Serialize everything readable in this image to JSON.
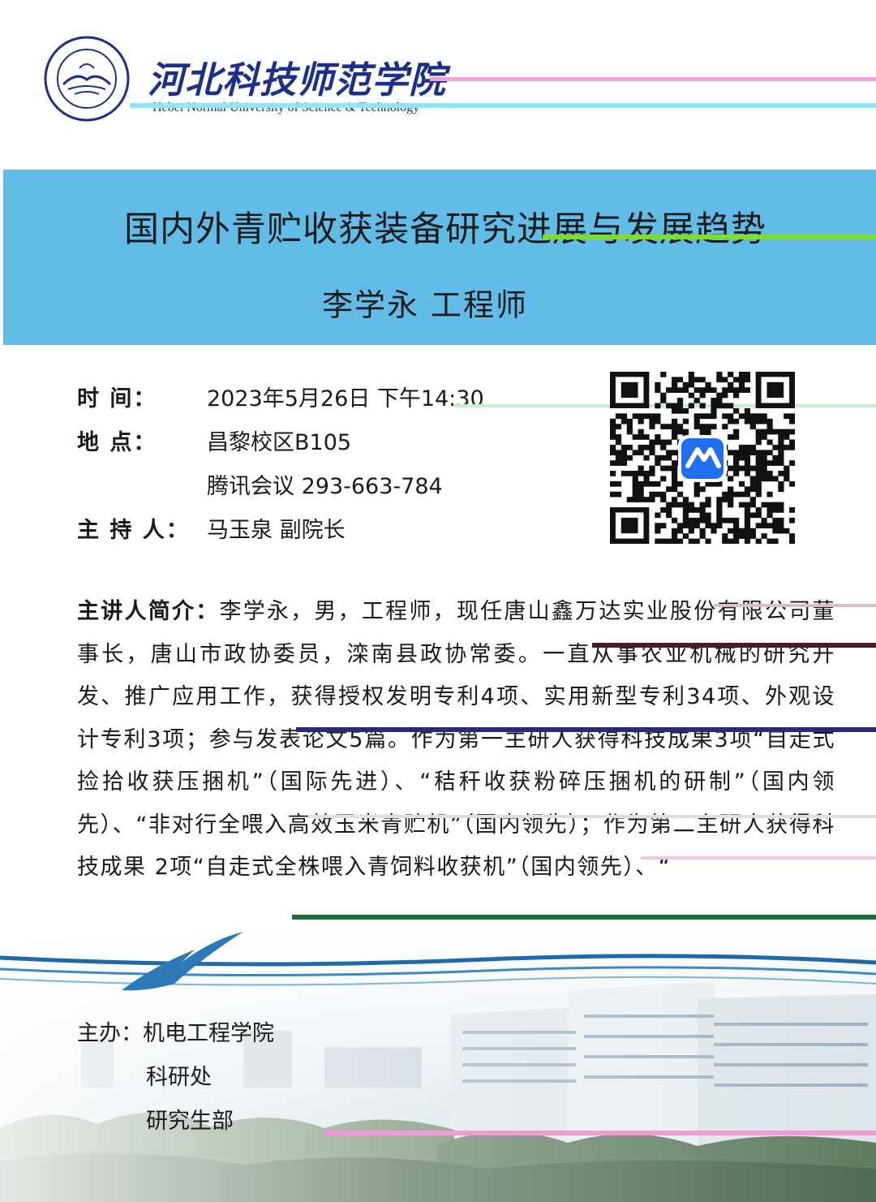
{
  "header": {
    "university_cn": "河北科技师范学院",
    "university_en": "Hebei Normal University of Science & Technology",
    "seal_icon": "university-seal-icon",
    "brand_color": "#1d2f8c"
  },
  "banner": {
    "title": "国内外青贮收获装备研究进展与发展趋势",
    "speaker": "李学永  工程师",
    "background_color": "#61bde8"
  },
  "info": {
    "time_label": "时  间：",
    "time_value": "2023年5月26日 下午14:30",
    "place_label": "地  点：",
    "place_value": "昌黎校区B105",
    "meeting_value": "腾讯会议 293-663-784",
    "host_label": "主 持 人：",
    "host_value": "马玉泉 副院长"
  },
  "qr": {
    "icon": "tencent-meeting-icon"
  },
  "intro": {
    "label": "主讲人简介：",
    "text": "李学永，男，工程师，现任唐山鑫万达实业股份有限公司董事长，唐山市政协委员，滦南县政协常委。一直从事农业机械的研究开发、推广应用工作，获得授权发明专利4项、实用新型专利34项、外观设计专利3项；参与发表论文5篇。作为第一主研人获得科技成果3项“自走式捡拾收获压捆机”（国际先进）、“秸秆收获粉碎压捆机的研制”（国内领先）、“非对行全喂入高效玉米青贮机”（国内领先）；作为第二主研人获得科技成果 2项“自走式全株喂入青饲料收获机”（国内领先）、“"
  },
  "footer": {
    "organizer_label": "主办：",
    "organizers": [
      "机电工程学院",
      "科研处",
      "研究生部"
    ],
    "bird_icon": "seagull-icon",
    "campus_image": "campus-photo"
  }
}
